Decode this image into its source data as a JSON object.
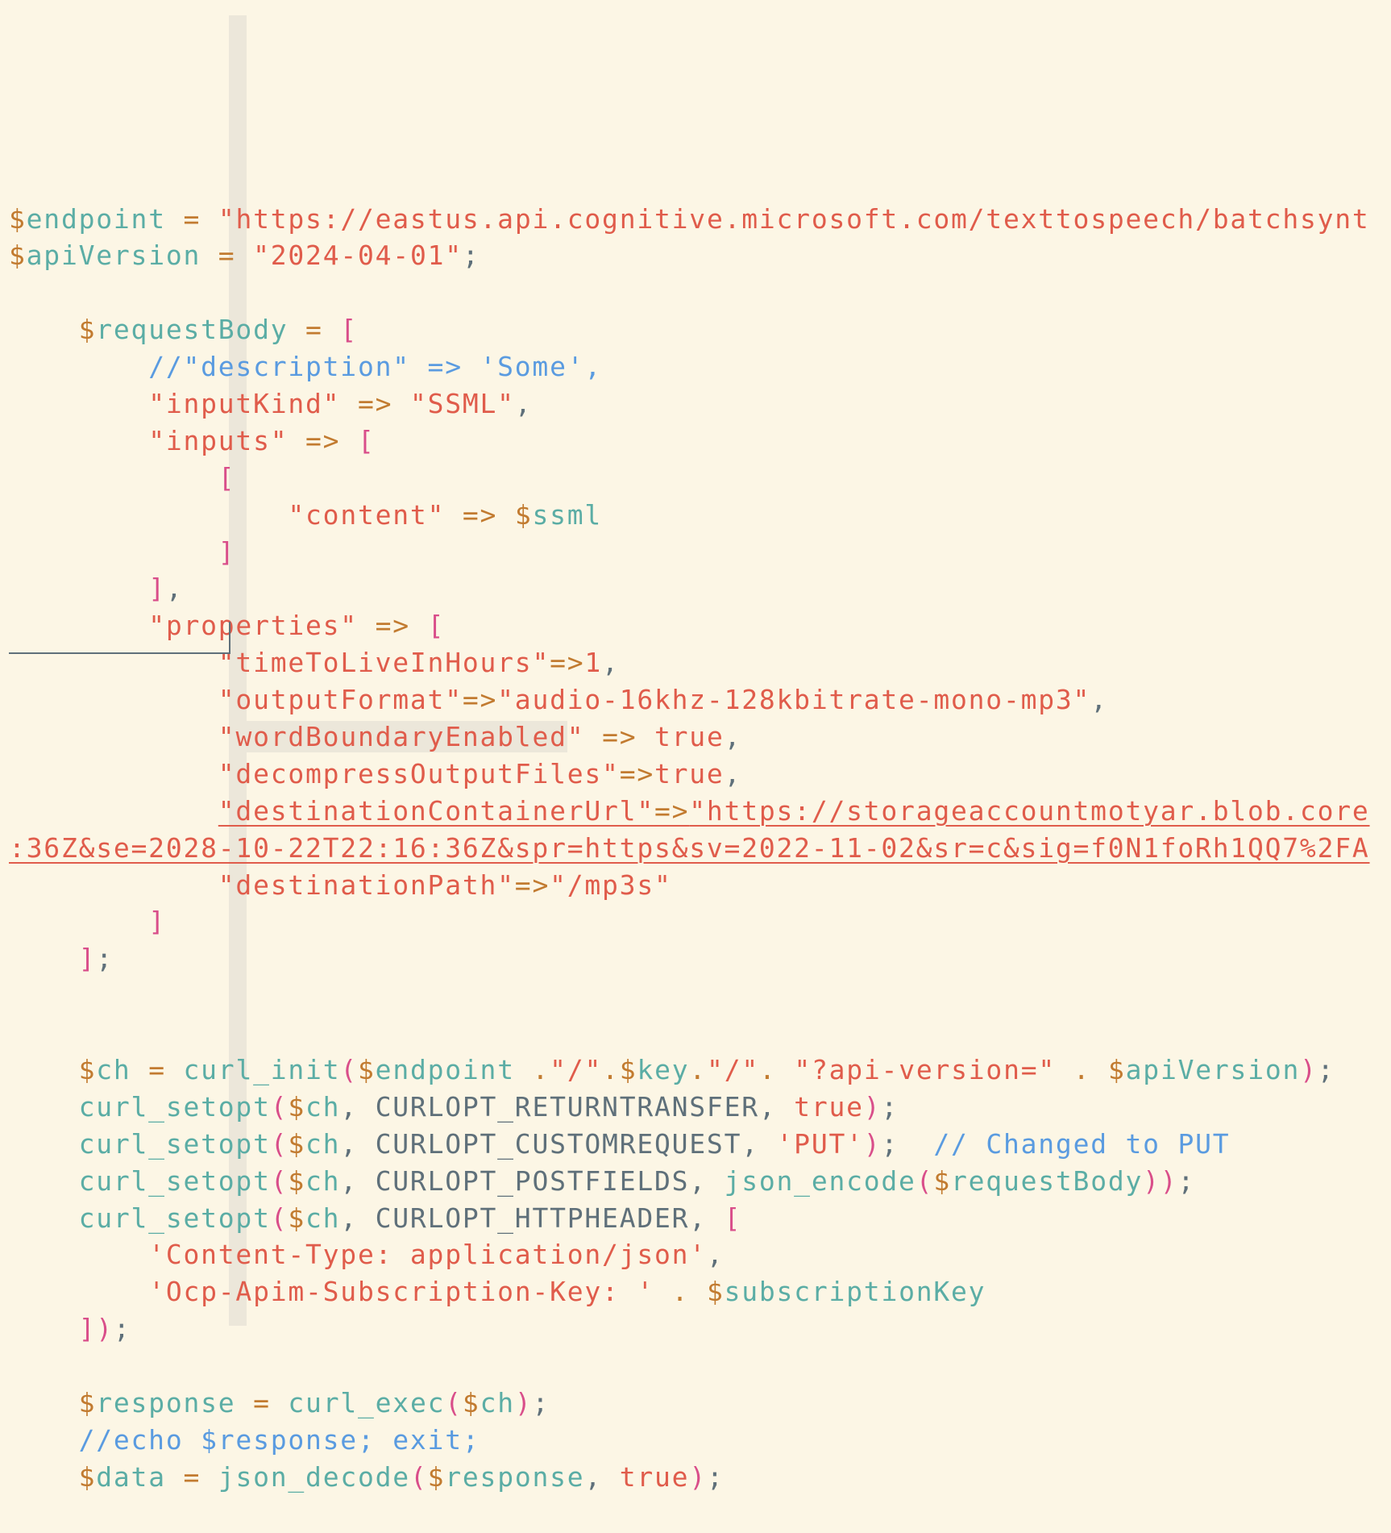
{
  "editor": {
    "language": "php",
    "lines": [
      [
        [
          "d",
          "$"
        ],
        [
          "v",
          "endpoint"
        ],
        [
          "p",
          " "
        ],
        [
          "d",
          "="
        ],
        [
          "p",
          " "
        ],
        [
          "s",
          "\"https://eastus.api.cognitive.microsoft.com/texttospeech/batchsynt"
        ]
      ],
      [
        [
          "d",
          "$"
        ],
        [
          "v",
          "apiVersion"
        ],
        [
          "p",
          " "
        ],
        [
          "d",
          "="
        ],
        [
          "p",
          " "
        ],
        [
          "s",
          "\"2024-04-01\""
        ],
        [
          "p",
          ";"
        ]
      ],
      [],
      [
        [
          "p",
          "    "
        ],
        [
          "d",
          "$"
        ],
        [
          "v",
          "requestBody"
        ],
        [
          "p",
          " "
        ],
        [
          "d",
          "="
        ],
        [
          "p",
          " "
        ],
        [
          "b",
          "["
        ]
      ],
      [
        [
          "p",
          "        "
        ],
        [
          "c",
          "//\"description\" => 'Some',"
        ]
      ],
      [
        [
          "p",
          "        "
        ],
        [
          "s",
          "\"inputKind\""
        ],
        [
          "p",
          " "
        ],
        [
          "d",
          "=>"
        ],
        [
          "p",
          " "
        ],
        [
          "s",
          "\"SSML\""
        ],
        [
          "p",
          ","
        ]
      ],
      [
        [
          "p",
          "        "
        ],
        [
          "s",
          "\"inputs\""
        ],
        [
          "p",
          " "
        ],
        [
          "d",
          "=>"
        ],
        [
          "p",
          " "
        ],
        [
          "b",
          "["
        ]
      ],
      [
        [
          "p",
          "            "
        ],
        [
          "b",
          "["
        ]
      ],
      [
        [
          "p",
          "                "
        ],
        [
          "s",
          "\"content\""
        ],
        [
          "p",
          " "
        ],
        [
          "d",
          "=>"
        ],
        [
          "p",
          " "
        ],
        [
          "d",
          "$"
        ],
        [
          "v",
          "ssml"
        ]
      ],
      [
        [
          "p",
          "            "
        ],
        [
          "b",
          "]"
        ]
      ],
      [
        [
          "p",
          "        "
        ],
        [
          "b",
          "]"
        ],
        [
          "p",
          ","
        ]
      ],
      [
        [
          "p",
          "        "
        ],
        [
          "s",
          "\"properties\""
        ],
        [
          "p",
          " "
        ],
        [
          "d",
          "=>"
        ],
        [
          "p",
          " "
        ],
        [
          "b",
          "["
        ]
      ],
      [
        [
          "p",
          "            "
        ],
        [
          "s",
          "\"timeToLiveInHours\""
        ],
        [
          "d",
          "=>"
        ],
        [
          "s",
          "1"
        ],
        [
          "p",
          ","
        ]
      ],
      [
        [
          "p",
          "            "
        ],
        [
          "s",
          "\"outputFormat\""
        ],
        [
          "d",
          "=>"
        ],
        [
          "s",
          "\"audio-16khz-128kbitrate-mono-mp3\""
        ],
        [
          "p",
          ","
        ]
      ],
      [
        [
          "p",
          "            "
        ],
        [
          "s",
          "\""
        ],
        [
          "shl",
          "wordBoundaryEnabled"
        ],
        [
          "s",
          "\""
        ],
        [
          "p",
          " "
        ],
        [
          "d",
          "=>"
        ],
        [
          "p",
          " "
        ],
        [
          "s",
          "true"
        ],
        [
          "p",
          ","
        ]
      ],
      [
        [
          "p",
          "            "
        ],
        [
          "s",
          "\"decompressOutputFiles\""
        ],
        [
          "d",
          "=>"
        ],
        [
          "s",
          "true"
        ],
        [
          "p",
          ","
        ]
      ],
      [
        [
          "p",
          "            "
        ],
        [
          "su",
          "\"destinationContainerUrl\""
        ],
        [
          "du",
          "=>"
        ],
        [
          "su",
          "\"https://storageaccountmotyar.blob.core"
        ]
      ],
      [
        [
          "su",
          ":36Z&se=2028-10-22T22:16:36Z&spr=https&sv=2022-11-02&sr=c&sig=f0N1foRh1QQ7%2FA"
        ]
      ],
      [
        [
          "p",
          "            "
        ],
        [
          "s",
          "\"destinationPath\""
        ],
        [
          "d",
          "=>"
        ],
        [
          "s",
          "\"/mp3s\""
        ]
      ],
      [
        [
          "p",
          "        "
        ],
        [
          "b",
          "]"
        ]
      ],
      [
        [
          "p",
          "    "
        ],
        [
          "b",
          "]"
        ],
        [
          "p",
          ";"
        ]
      ],
      [],
      [],
      [
        [
          "p",
          "    "
        ],
        [
          "d",
          "$"
        ],
        [
          "v",
          "ch"
        ],
        [
          "p",
          " "
        ],
        [
          "d",
          "="
        ],
        [
          "p",
          " "
        ],
        [
          "v",
          "curl_init"
        ],
        [
          "b",
          "("
        ],
        [
          "d",
          "$"
        ],
        [
          "v",
          "endpoint"
        ],
        [
          "p",
          " "
        ],
        [
          "d",
          "."
        ],
        [
          "s",
          "\"/\""
        ],
        [
          "d",
          "."
        ],
        [
          "d",
          "$"
        ],
        [
          "v",
          "key"
        ],
        [
          "d",
          "."
        ],
        [
          "s",
          "\"/\""
        ],
        [
          "d",
          "."
        ],
        [
          "p",
          " "
        ],
        [
          "s",
          "\"?api-version=\""
        ],
        [
          "p",
          " "
        ],
        [
          "d",
          "."
        ],
        [
          "p",
          " "
        ],
        [
          "d",
          "$"
        ],
        [
          "v",
          "apiVersion"
        ],
        [
          "b",
          ")"
        ],
        [
          "p",
          ";"
        ]
      ],
      [
        [
          "p",
          "    "
        ],
        [
          "v",
          "curl_setopt"
        ],
        [
          "b",
          "("
        ],
        [
          "d",
          "$"
        ],
        [
          "v",
          "ch"
        ],
        [
          "p",
          ", CURLOPT_RETURNTRANSFER, "
        ],
        [
          "s",
          "true"
        ],
        [
          "b",
          ")"
        ],
        [
          "p",
          ";"
        ]
      ],
      [
        [
          "p",
          "    "
        ],
        [
          "v",
          "curl_setopt"
        ],
        [
          "b",
          "("
        ],
        [
          "d",
          "$"
        ],
        [
          "v",
          "ch"
        ],
        [
          "p",
          ", CURLOPT_CUSTOMREQUEST, "
        ],
        [
          "s",
          "'PUT'"
        ],
        [
          "b",
          ")"
        ],
        [
          "p",
          ";  "
        ],
        [
          "c",
          "// Changed to PUT"
        ]
      ],
      [
        [
          "p",
          "    "
        ],
        [
          "v",
          "curl_setopt"
        ],
        [
          "b",
          "("
        ],
        [
          "d",
          "$"
        ],
        [
          "v",
          "ch"
        ],
        [
          "p",
          ", CURLOPT_POSTFIELDS, "
        ],
        [
          "v",
          "json_encode"
        ],
        [
          "b",
          "("
        ],
        [
          "d",
          "$"
        ],
        [
          "v",
          "requestBody"
        ],
        [
          "b",
          "))"
        ],
        [
          "p",
          ";"
        ]
      ],
      [
        [
          "p",
          "    "
        ],
        [
          "v",
          "curl_setopt"
        ],
        [
          "b",
          "("
        ],
        [
          "d",
          "$"
        ],
        [
          "v",
          "ch"
        ],
        [
          "p",
          ", CURLOPT_HTTPHEADER, "
        ],
        [
          "b",
          "["
        ]
      ],
      [
        [
          "p",
          "        "
        ],
        [
          "s",
          "'Content-Type: application/json'"
        ],
        [
          "p",
          ","
        ]
      ],
      [
        [
          "p",
          "        "
        ],
        [
          "s",
          "'Ocp-Apim-Subscription-Key: '"
        ],
        [
          "p",
          " "
        ],
        [
          "d",
          "."
        ],
        [
          "p",
          " "
        ],
        [
          "d",
          "$"
        ],
        [
          "v",
          "subscriptionKey"
        ]
      ],
      [
        [
          "p",
          "    "
        ],
        [
          "b",
          "])"
        ],
        [
          "p",
          ";"
        ]
      ],
      [],
      [
        [
          "p",
          "    "
        ],
        [
          "d",
          "$"
        ],
        [
          "v",
          "response"
        ],
        [
          "p",
          " "
        ],
        [
          "d",
          "="
        ],
        [
          "p",
          " "
        ],
        [
          "v",
          "curl_exec"
        ],
        [
          "b",
          "("
        ],
        [
          "d",
          "$"
        ],
        [
          "v",
          "ch"
        ],
        [
          "b",
          ")"
        ],
        [
          "p",
          ";"
        ]
      ],
      [
        [
          "p",
          "    "
        ],
        [
          "c",
          "//echo $response; exit;"
        ]
      ],
      [
        [
          "p",
          "    "
        ],
        [
          "d",
          "$"
        ],
        [
          "v",
          "data"
        ],
        [
          "p",
          " "
        ],
        [
          "d",
          "="
        ],
        [
          "p",
          " "
        ],
        [
          "v",
          "json_decode"
        ],
        [
          "b",
          "("
        ],
        [
          "d",
          "$"
        ],
        [
          "v",
          "response"
        ],
        [
          "p",
          ", "
        ],
        [
          "s",
          "true"
        ],
        [
          "b",
          ")"
        ],
        [
          "p",
          ";"
        ]
      ]
    ]
  },
  "colors": {
    "background": "#FCF6E5",
    "variable": "#5BADA5",
    "sigil_operator": "#C27B30",
    "string": "#E05C4B",
    "bracket": "#D94E8A",
    "comment": "#5A9BE0",
    "punctuation": "#5F707A",
    "indent_guide": "#ECE7DA"
  }
}
